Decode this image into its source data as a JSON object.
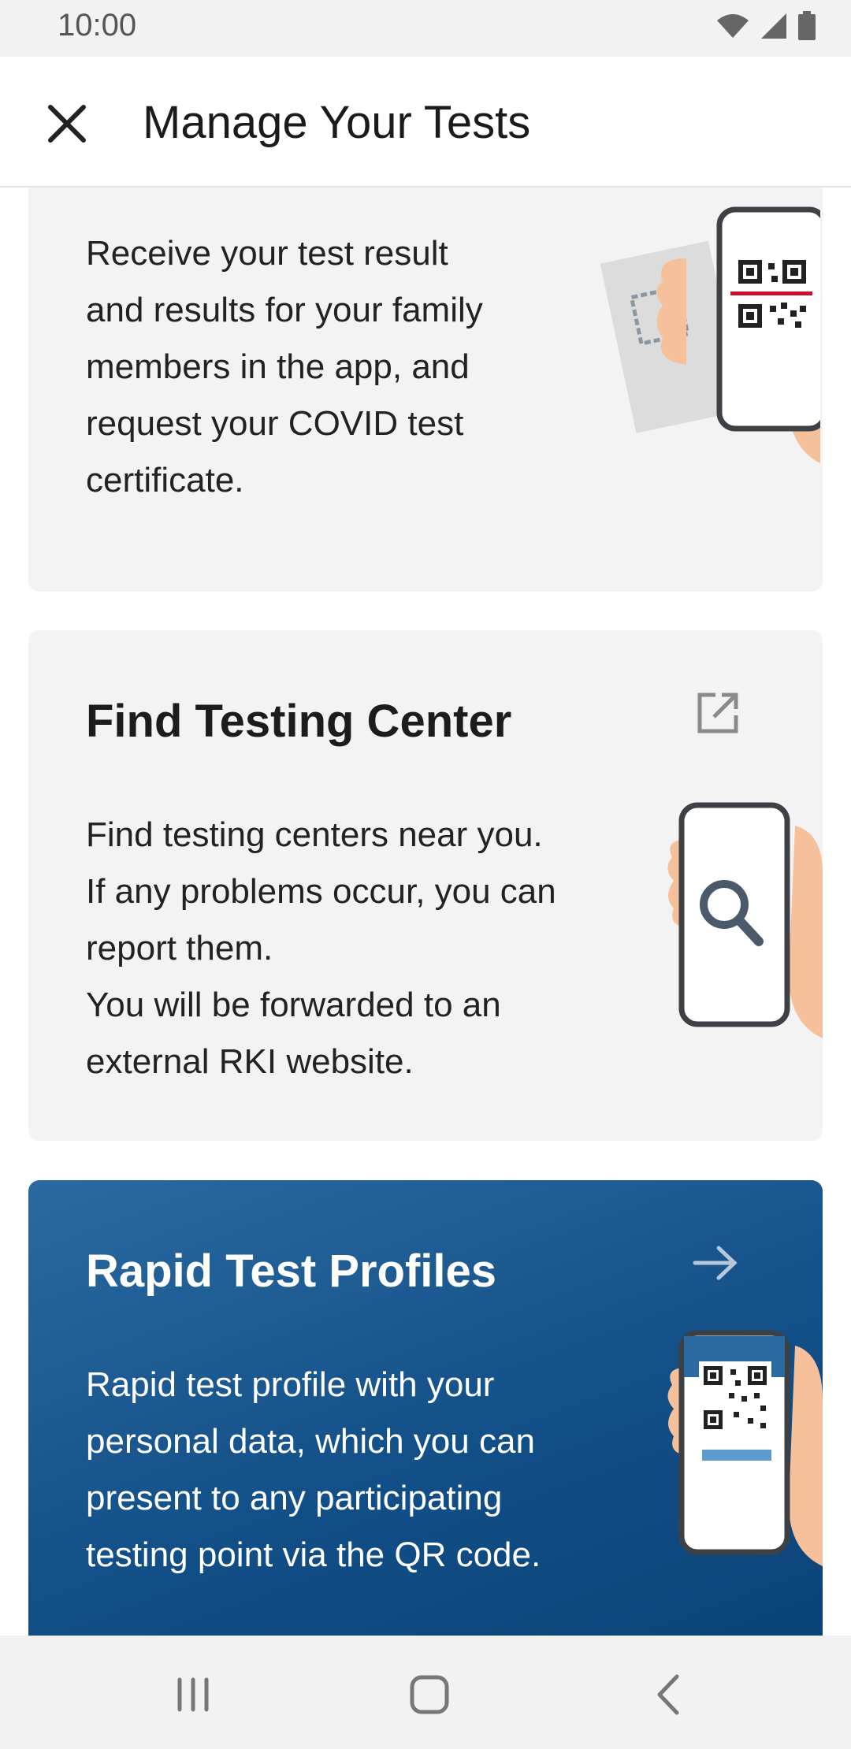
{
  "status": {
    "time": "10:00"
  },
  "header": {
    "title": "Manage Your Tests"
  },
  "cards": [
    {
      "text": "Receive your test result\nand results for your family\nmembers in the app, and\nrequest your COVID test\ncertificate."
    },
    {
      "title": "Find Testing Center",
      "text": "Find testing centers near you.\nIf any problems occur, you can\nreport them.\nYou will be forwarded to an\nexternal RKI website."
    },
    {
      "title": "Rapid Test Profiles",
      "text": "Rapid test profile with your\npersonal data, which you can\npresent to any participating\ntesting point via the QR code."
    }
  ],
  "colors": {
    "card_bg": "#f3f3f3",
    "accent_blue": "#124e86",
    "skin": "#f5c09a",
    "phone_outline": "#3d4145",
    "scan_line": "#c8102e"
  }
}
